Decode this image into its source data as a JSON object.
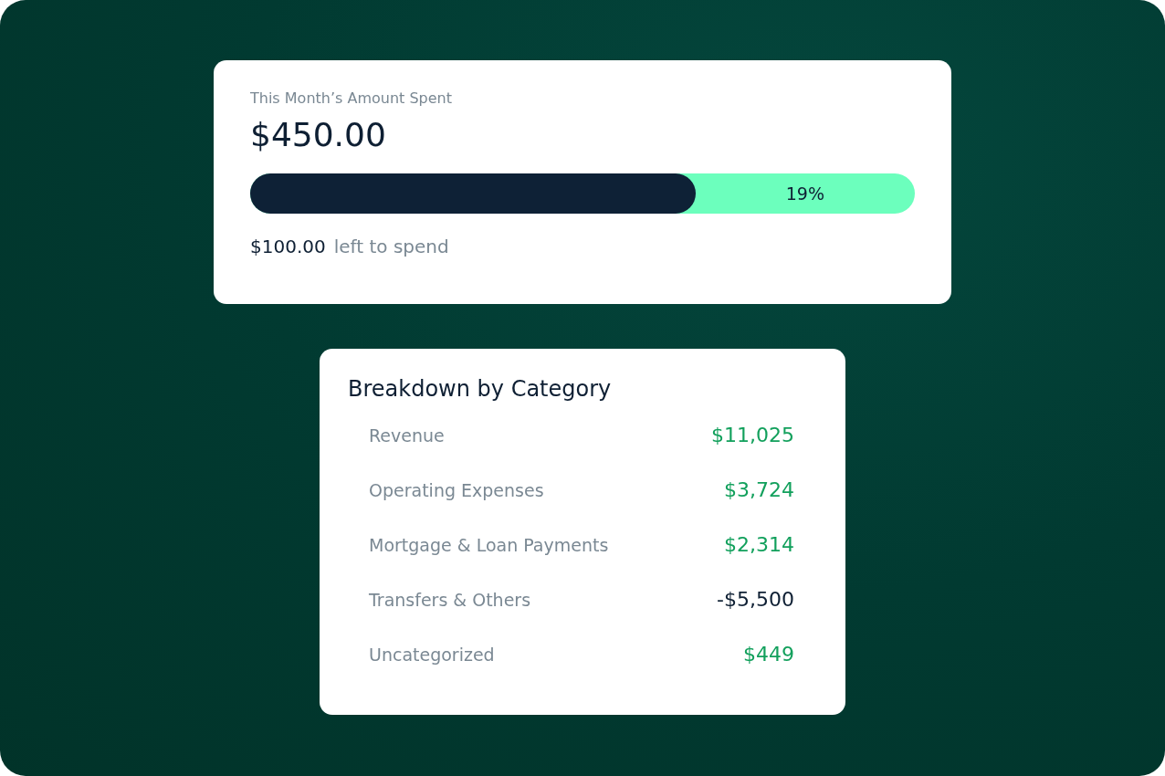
{
  "spending_card": {
    "label": "This Month’s Amount Spent",
    "amount": "$450.00",
    "progress": {
      "level": 0.67,
      "reading": "19%"
    },
    "remaining_amount": "$100.00",
    "remaining_label": "left to spend"
  },
  "breakdown_card": {
    "title": "Breakdown by Category",
    "rows": [
      {
        "label": "Revenue",
        "amount": "$11,025",
        "color": "#12a05c"
      },
      {
        "label": "Operating Expenses",
        "amount": "$3,724",
        "color": "#12a05c"
      },
      {
        "label": "Mortgage & Loan Payments",
        "amount": "$2,314",
        "color": "#12a05c"
      },
      {
        "label": "Transfers & Others",
        "amount": "-$5,500",
        "color": "#0e1f33"
      },
      {
        "label": "Uncategorized",
        "amount": "$449",
        "color": "#12a05c"
      }
    ]
  }
}
